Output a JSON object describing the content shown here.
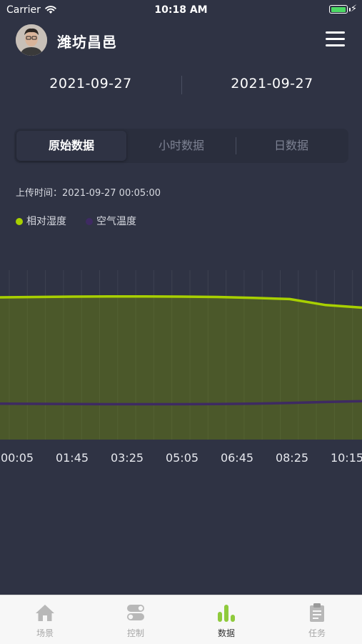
{
  "status_bar": {
    "carrier": "Carrier",
    "time": "10:18 AM",
    "battery_level": 1.0
  },
  "header": {
    "title": "潍坊昌邑"
  },
  "dates": {
    "start": "2021-09-27",
    "end": "2021-09-27"
  },
  "tabs": [
    {
      "label": "原始数据",
      "active": true
    },
    {
      "label": "小时数据",
      "active": false
    },
    {
      "label": "日数据",
      "active": false
    }
  ],
  "upload_time": "上传时间：2021-09-27 00:05:00",
  "colors": {
    "background": "#2f3344",
    "humidity": "#a8d000",
    "temperature": "#3e2a62"
  },
  "chart_data": {
    "type": "area",
    "x_tick_labels": [
      "00:05",
      "01:45",
      "03:25",
      "05:05",
      "06:45",
      "08:25",
      "10:15"
    ],
    "y_axis_visible": false,
    "grid": "vertical",
    "legend_position": "top-left",
    "series": [
      {
        "name": "相对湿度",
        "color": "#a8d000",
        "filled": true,
        "values": [
          82.5,
          82.7,
          82.9,
          83.0,
          83.0,
          82.9,
          82.7,
          82.2,
          81.5,
          78.0,
          76.5
        ]
      },
      {
        "name": "空气温度",
        "color": "#3e2a62",
        "filled": false,
        "values": [
          20.5,
          20.4,
          20.3,
          20.2,
          20.2,
          20.2,
          20.3,
          20.5,
          20.9,
          21.5,
          22.0
        ]
      }
    ]
  },
  "tabbar": [
    {
      "label": "场景",
      "icon": "home-icon",
      "active": false
    },
    {
      "label": "控制",
      "icon": "toggle-icon",
      "active": false
    },
    {
      "label": "数据",
      "icon": "bar-chart-icon",
      "active": true
    },
    {
      "label": "任务",
      "icon": "clipboard-icon",
      "active": false
    }
  ]
}
